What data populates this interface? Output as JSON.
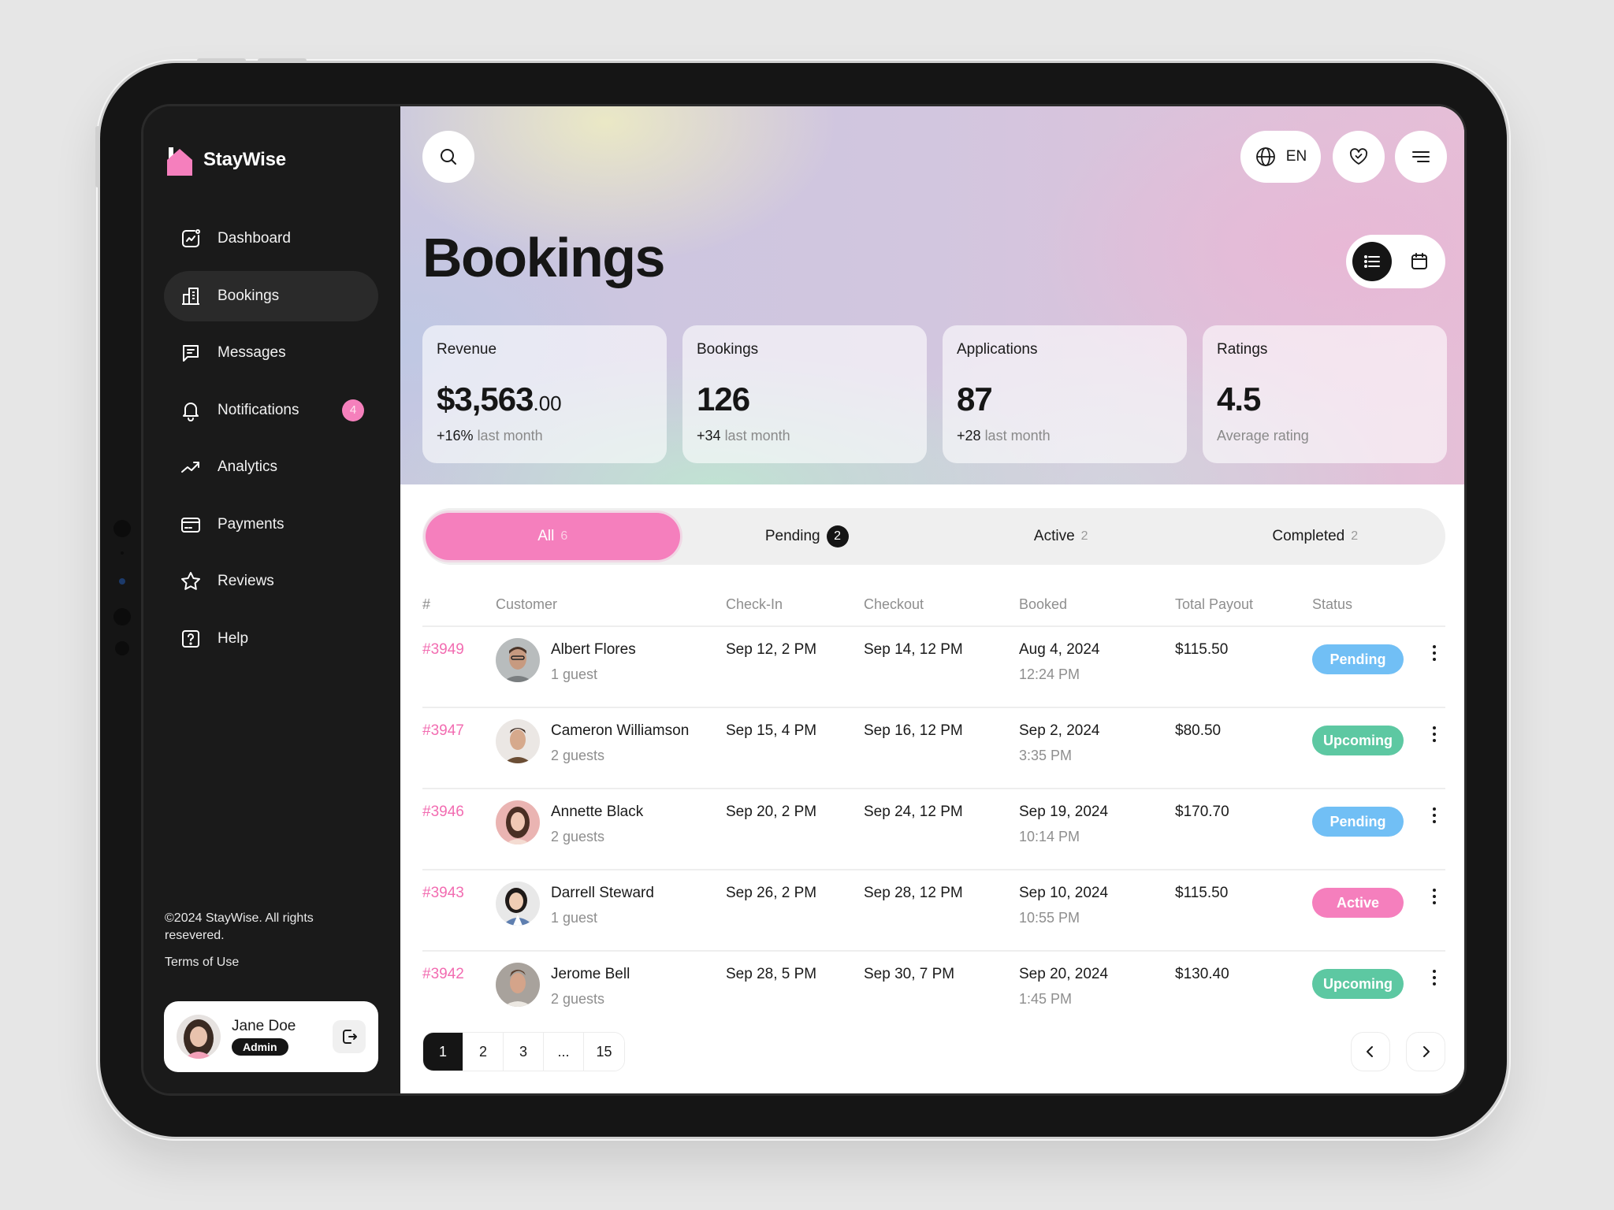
{
  "app": {
    "brand_name": "StayWise",
    "brand_color": "#f57fbd"
  },
  "sidebar": {
    "items": [
      {
        "label": "Dashboard",
        "icon": "dashboard-chart-icon",
        "active": false
      },
      {
        "label": "Bookings",
        "icon": "building-icon",
        "active": true
      },
      {
        "label": "Messages",
        "icon": "message-icon",
        "active": false
      },
      {
        "label": "Notifications",
        "icon": "bell-icon",
        "active": false,
        "badge": "4"
      },
      {
        "label": "Analytics",
        "icon": "trend-up-icon",
        "active": false
      },
      {
        "label": "Payments",
        "icon": "credit-card-icon",
        "active": false
      },
      {
        "label": "Reviews",
        "icon": "star-icon",
        "active": false
      },
      {
        "label": "Help",
        "icon": "help-icon",
        "active": false
      }
    ],
    "copyright": "©2024 StayWise. All rights resevered.",
    "terms": "Terms of Use",
    "user": {
      "name": "Jane Doe",
      "role": "Admin"
    }
  },
  "header": {
    "language": "EN",
    "page_title": "Bookings"
  },
  "stats": [
    {
      "label": "Revenue",
      "value": "$3,563",
      "cents": ".00",
      "delta": "+16%",
      "sub": "last month"
    },
    {
      "label": "Bookings",
      "value": "126",
      "cents": "",
      "delta": "+34",
      "sub": "last month"
    },
    {
      "label": "Applications",
      "value": "87",
      "cents": "",
      "delta": "+28",
      "sub": "last month"
    },
    {
      "label": "Ratings",
      "value": "4.5",
      "cents": "",
      "delta": "",
      "sub": "Average rating"
    }
  ],
  "tabs": [
    {
      "label": "All",
      "count": "6",
      "active": true
    },
    {
      "label": "Pending",
      "count": "2",
      "active": false,
      "highlight": true
    },
    {
      "label": "Active",
      "count": "2",
      "active": false
    },
    {
      "label": "Completed",
      "count": "2",
      "active": false
    }
  ],
  "table": {
    "columns": [
      "#",
      "Customer",
      "Check-In",
      "Checkout",
      "Booked",
      "Total Payout",
      "Status"
    ],
    "rows": [
      {
        "id": "#3949",
        "customer": "Albert Flores",
        "guests": "1 guest",
        "check_in": "Sep 12, 2 PM",
        "checkout": "Sep 14, 12 PM",
        "booked_date": "Aug 4, 2024",
        "booked_time": "12:24 PM",
        "payout": "$115.50",
        "status": "Pending"
      },
      {
        "id": "#3947",
        "customer": "Cameron Williamson",
        "guests": "2 guests",
        "check_in": "Sep 15, 4 PM",
        "checkout": "Sep 16, 12 PM",
        "booked_date": "Sep 2, 2024",
        "booked_time": "3:35 PM",
        "payout": "$80.50",
        "status": "Upcoming"
      },
      {
        "id": "#3946",
        "customer": "Annette Black",
        "guests": "2 guests",
        "check_in": "Sep 20, 2 PM",
        "checkout": "Sep 24, 12 PM",
        "booked_date": "Sep 19, 2024",
        "booked_time": "10:14 PM",
        "payout": "$170.70",
        "status": "Pending"
      },
      {
        "id": "#3943",
        "customer": "Darrell Steward",
        "guests": "1 guest",
        "check_in": "Sep 26, 2 PM",
        "checkout": "Sep 28, 12 PM",
        "booked_date": "Sep 10, 2024",
        "booked_time": "10:55 PM",
        "payout": "$115.50",
        "status": "Active"
      },
      {
        "id": "#3942",
        "customer": "Jerome Bell",
        "guests": "2 guests",
        "check_in": "Sep 28, 5 PM",
        "checkout": "Sep 30, 7 PM",
        "booked_date": "Sep 20, 2024",
        "booked_time": "1:45 PM",
        "payout": "$130.40",
        "status": "Upcoming"
      }
    ]
  },
  "status_colors": {
    "Pending": "#71bff5",
    "Upcoming": "#5dc8a2",
    "Active": "#f57fbd"
  },
  "pagination": {
    "pages": [
      "1",
      "2",
      "3",
      "...",
      "15"
    ],
    "current": "1"
  }
}
